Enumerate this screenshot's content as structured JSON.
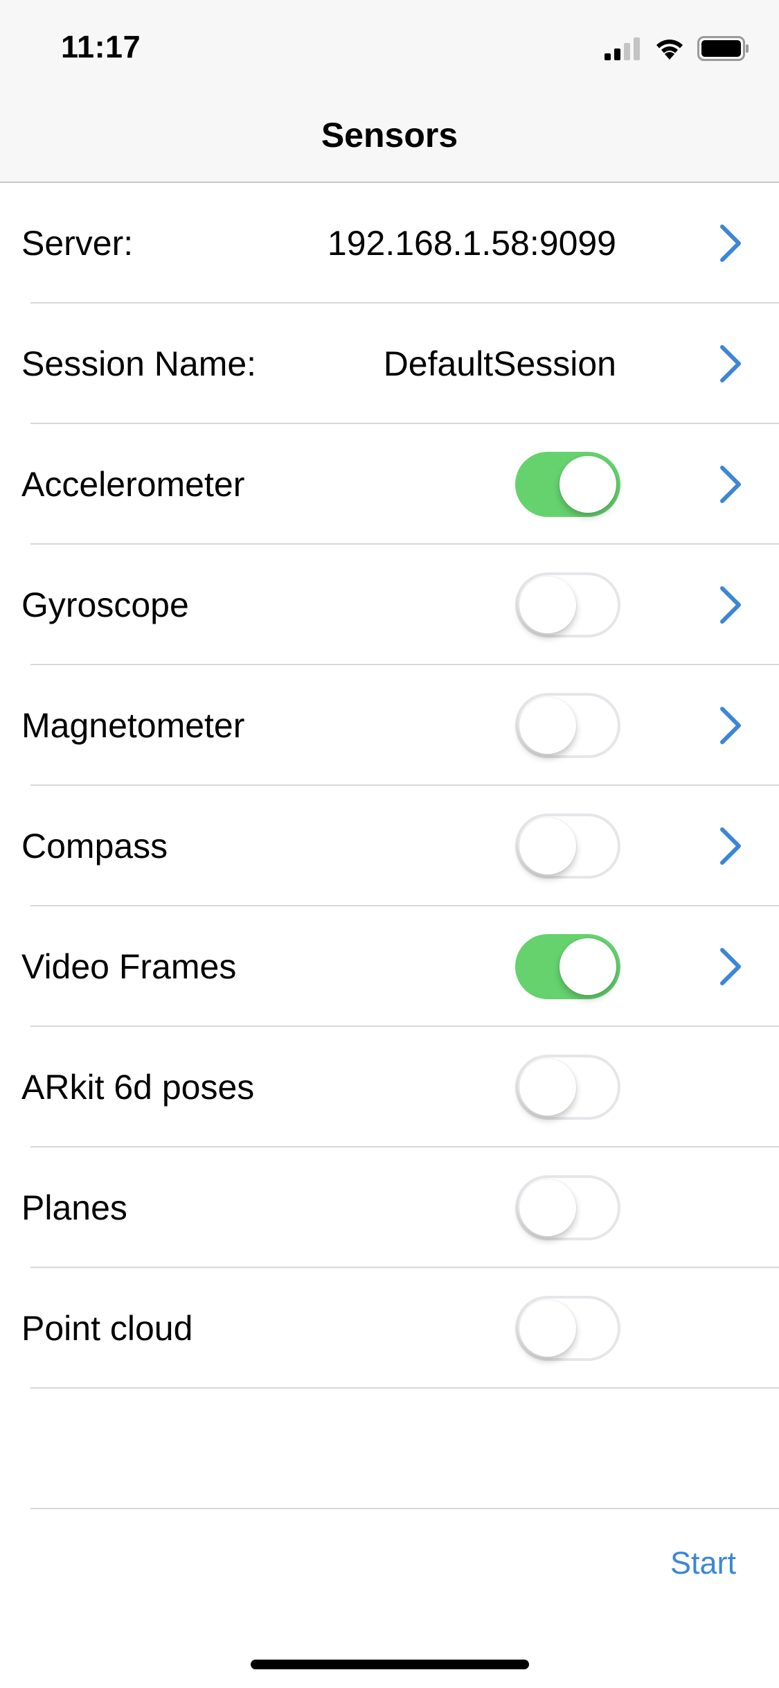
{
  "status_bar": {
    "time": "11:17",
    "icons": [
      "cellular-signal-icon",
      "wifi-icon",
      "battery-icon"
    ]
  },
  "nav": {
    "title": "Sensors"
  },
  "colors": {
    "accent": "#3c86d8",
    "toggle_on": "#65d26e"
  },
  "rows": [
    {
      "label": "Server:",
      "value": "192.168.1.58:9099",
      "has_chevron": true
    },
    {
      "label": "Session Name:",
      "value": "DefaultSession",
      "has_chevron": true
    },
    {
      "label": "Accelerometer",
      "toggle": true,
      "has_chevron": true
    },
    {
      "label": "Gyroscope",
      "toggle": false,
      "has_chevron": true
    },
    {
      "label": "Magnetometer",
      "toggle": false,
      "has_chevron": true
    },
    {
      "label": "Compass",
      "toggle": false,
      "has_chevron": true
    },
    {
      "label": "Video Frames",
      "toggle": true,
      "has_chevron": true
    },
    {
      "label": "ARkit 6d poses",
      "toggle": false,
      "has_chevron": false
    },
    {
      "label": "Planes",
      "toggle": false,
      "has_chevron": false
    },
    {
      "label": "Point cloud",
      "toggle": false,
      "has_chevron": false
    }
  ],
  "footer": {
    "start_label": "Start"
  }
}
